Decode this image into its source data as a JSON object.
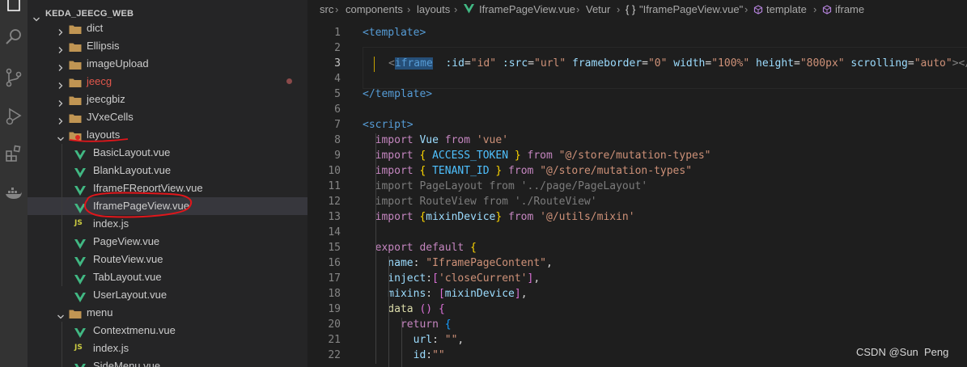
{
  "explorer": {
    "root_title": "KEDA_JEECG_WEB",
    "items": [
      {
        "label": "dict",
        "kind": "folder",
        "state": "collapsed"
      },
      {
        "label": "Ellipsis",
        "kind": "folder",
        "state": "collapsed"
      },
      {
        "label": "imageUpload",
        "kind": "folder",
        "state": "collapsed"
      },
      {
        "label": "jeecg",
        "kind": "folder",
        "state": "collapsed",
        "modified": true
      },
      {
        "label": "jeecgbiz",
        "kind": "folder",
        "state": "collapsed"
      },
      {
        "label": "JVxeCells",
        "kind": "folder",
        "state": "collapsed"
      },
      {
        "label": "layouts",
        "kind": "folder",
        "state": "expanded"
      },
      {
        "label": "BasicLayout.vue",
        "kind": "vue"
      },
      {
        "label": "BlankLayout.vue",
        "kind": "vue"
      },
      {
        "label": "IframeFReportView.vue",
        "kind": "vue"
      },
      {
        "label": "IframePageView.vue",
        "kind": "vue",
        "selected": true
      },
      {
        "label": "index.js",
        "kind": "js"
      },
      {
        "label": "PageView.vue",
        "kind": "vue"
      },
      {
        "label": "RouteView.vue",
        "kind": "vue"
      },
      {
        "label": "TabLayout.vue",
        "kind": "vue"
      },
      {
        "label": "UserLayout.vue",
        "kind": "vue"
      },
      {
        "label": "menu",
        "kind": "folder",
        "state": "expanded"
      },
      {
        "label": "Contextmenu.vue",
        "kind": "vue"
      },
      {
        "label": "index.js",
        "kind": "js"
      },
      {
        "label": "SideMenu.vue",
        "kind": "vue"
      }
    ]
  },
  "breadcrumb": {
    "src": "src",
    "components": "components",
    "layouts": "layouts",
    "file": "IframePageView.vue",
    "vetur": "Vetur",
    "braces": "{ }",
    "module": "\"IframePageView.vue\"",
    "template": "template",
    "iframe": "iframe"
  },
  "code_lines": [
    {
      "n": "1",
      "tokens": [
        [
          "<template>",
          "#569cd6"
        ]
      ]
    },
    {
      "n": "2",
      "tokens": []
    },
    {
      "n": "3",
      "tokens": [
        [
          "<",
          "#808080"
        ],
        [
          "iframe",
          "#569cd6"
        ],
        [
          "  :id",
          "#9cdcfe"
        ],
        [
          "=",
          "#d4d4d4"
        ],
        [
          "\"id\"",
          "#ce9178"
        ],
        [
          " :src",
          "#9cdcfe"
        ],
        [
          "=",
          "#d4d4d4"
        ],
        [
          "\"url\"",
          "#ce9178"
        ],
        [
          " frameborder",
          "#9cdcfe"
        ],
        [
          "=",
          "#d4d4d4"
        ],
        [
          "\"0\"",
          "#ce9178"
        ],
        [
          " width",
          "#9cdcfe"
        ],
        [
          "=",
          "#d4d4d4"
        ],
        [
          "\"100%\"",
          "#ce9178"
        ],
        [
          " height",
          "#9cdcfe"
        ],
        [
          "=",
          "#d4d4d4"
        ],
        [
          "\"800px\"",
          "#ce9178"
        ],
        [
          " scrolling",
          "#9cdcfe"
        ],
        [
          "=",
          "#d4d4d4"
        ],
        [
          "\"auto\"",
          "#ce9178"
        ],
        [
          "></",
          "#808080"
        ],
        [
          "i",
          "#569cd6"
        ]
      ]
    },
    {
      "n": "4",
      "tokens": []
    },
    {
      "n": "5",
      "tokens": [
        [
          "</template>",
          "#569cd6"
        ]
      ]
    },
    {
      "n": "6",
      "tokens": []
    },
    {
      "n": "7",
      "tokens": [
        [
          "<script>",
          "#569cd6"
        ]
      ]
    },
    {
      "n": "8",
      "tokens": [
        [
          "  import ",
          "#c586c0"
        ],
        [
          "Vue ",
          "#9cdcfe"
        ],
        [
          "from ",
          "#c586c0"
        ],
        [
          "'vue'",
          "#ce9178"
        ]
      ]
    },
    {
      "n": "9",
      "tokens": [
        [
          "  import ",
          "#c586c0"
        ],
        [
          "{ ",
          "#ffd700"
        ],
        [
          "ACCESS_TOKEN ",
          "#4fc1ff"
        ],
        [
          "} ",
          "#ffd700"
        ],
        [
          "from ",
          "#c586c0"
        ],
        [
          "\"@/store/mutation-types\"",
          "#ce9178"
        ]
      ]
    },
    {
      "n": "10",
      "tokens": [
        [
          "  import ",
          "#c586c0"
        ],
        [
          "{ ",
          "#ffd700"
        ],
        [
          "TENANT_ID ",
          "#4fc1ff"
        ],
        [
          "} ",
          "#ffd700"
        ],
        [
          "from ",
          "#c586c0"
        ],
        [
          "\"@/store/mutation-types\"",
          "#ce9178"
        ]
      ]
    },
    {
      "n": "11",
      "tokens": [
        [
          "  import PageLayout from '../page/PageLayout'",
          "#7c7c7c"
        ]
      ]
    },
    {
      "n": "12",
      "tokens": [
        [
          "  import RouteView from './RouteView'",
          "#7c7c7c"
        ]
      ]
    },
    {
      "n": "13",
      "tokens": [
        [
          "  import ",
          "#c586c0"
        ],
        [
          "{",
          "#ffd700"
        ],
        [
          "mixinDevice",
          "#9cdcfe"
        ],
        [
          "} ",
          "#ffd700"
        ],
        [
          "from ",
          "#c586c0"
        ],
        [
          "'@/utils/mixin'",
          "#ce9178"
        ]
      ]
    },
    {
      "n": "14",
      "tokens": []
    },
    {
      "n": "15",
      "tokens": [
        [
          "  export default ",
          "#c586c0"
        ],
        [
          "{",
          "#ffd700"
        ]
      ]
    },
    {
      "n": "16",
      "tokens": [
        [
          "    name",
          "#9cdcfe"
        ],
        [
          ": ",
          "#d4d4d4"
        ],
        [
          "\"IframePageContent\"",
          "#ce9178"
        ],
        [
          ",",
          "#d4d4d4"
        ]
      ]
    },
    {
      "n": "17",
      "tokens": [
        [
          "    inject",
          "#9cdcfe"
        ],
        [
          ":",
          "#d4d4d4"
        ],
        [
          "[",
          "#da70d6"
        ],
        [
          "'closeCurrent'",
          "#ce9178"
        ],
        [
          "]",
          "#da70d6"
        ],
        [
          ",",
          "#d4d4d4"
        ]
      ]
    },
    {
      "n": "18",
      "tokens": [
        [
          "    mixins",
          "#9cdcfe"
        ],
        [
          ": ",
          "#d4d4d4"
        ],
        [
          "[",
          "#da70d6"
        ],
        [
          "mixinDevice",
          "#9cdcfe"
        ],
        [
          "]",
          "#da70d6"
        ],
        [
          ",",
          "#d4d4d4"
        ]
      ]
    },
    {
      "n": "19",
      "tokens": [
        [
          "    data ",
          "#dcdcaa"
        ],
        [
          "() ",
          "#da70d6"
        ],
        [
          "{",
          "#da70d6"
        ]
      ]
    },
    {
      "n": "20",
      "tokens": [
        [
          "      return ",
          "#c586c0"
        ],
        [
          "{",
          "#179fff"
        ]
      ]
    },
    {
      "n": "21",
      "tokens": [
        [
          "        url",
          "#9cdcfe"
        ],
        [
          ": ",
          "#d4d4d4"
        ],
        [
          "\"\"",
          "#ce9178"
        ],
        [
          ",",
          "#d4d4d4"
        ]
      ]
    },
    {
      "n": "22",
      "tokens": [
        [
          "        id",
          "#9cdcfe"
        ],
        [
          ":",
          "#d4d4d4"
        ],
        [
          "\"\"",
          "#ce9178"
        ]
      ]
    }
  ],
  "watermark": "CSDN @Sun  Peng",
  "colors": {
    "folder": "#c09553",
    "vue": "#41b883",
    "js": "#cbcb41",
    "modified_label": "#e2574c",
    "annotation": "#e0161b"
  }
}
